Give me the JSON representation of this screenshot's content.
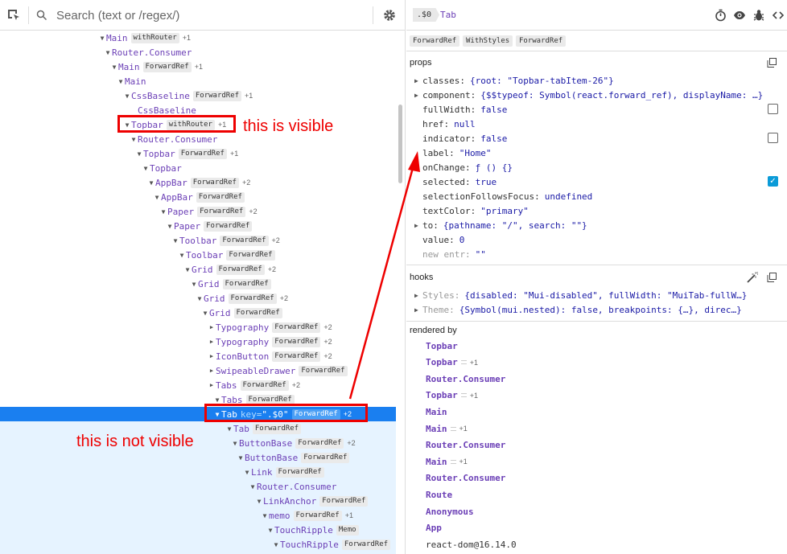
{
  "search": {
    "placeholder": "Search (text or /regex/)"
  },
  "icons": {
    "select": "cursor-select-icon",
    "search": "search-icon",
    "settings": "gear-icon",
    "timer": "stopwatch-icon",
    "inspect": "eye-icon",
    "debug": "bug-icon",
    "source": "code-icon"
  },
  "colors": {
    "accent": "#1a7ff0",
    "component": "#6b3fb6",
    "annotation": "#e00000",
    "checkbox_checked": "#0b9bd8"
  },
  "tree": [
    {
      "name": "Main",
      "badge": "withRouter",
      "plus": "+1"
    },
    {
      "name": "Router.Consumer"
    },
    {
      "name": "Main",
      "badge": "ForwardRef",
      "plus": "+1"
    },
    {
      "name": "Main"
    },
    {
      "name": "CssBaseline",
      "badge": "ForwardRef",
      "plus": "+1"
    },
    {
      "name": "CssBaseline"
    },
    {
      "name": "Topbar",
      "badge": "withRouter",
      "plus": "+1"
    },
    {
      "name": "Router.Consumer"
    },
    {
      "name": "Topbar",
      "badge": "ForwardRef",
      "plus": "+1"
    },
    {
      "name": "Topbar"
    },
    {
      "name": "AppBar",
      "badge": "ForwardRef",
      "plus": "+2"
    },
    {
      "name": "AppBar",
      "badge": "ForwardRef"
    },
    {
      "name": "Paper",
      "badge": "ForwardRef",
      "plus": "+2"
    },
    {
      "name": "Paper",
      "badge": "ForwardRef"
    },
    {
      "name": "Toolbar",
      "badge": "ForwardRef",
      "plus": "+2"
    },
    {
      "name": "Toolbar",
      "badge": "ForwardRef"
    },
    {
      "name": "Grid",
      "badge": "ForwardRef",
      "plus": "+2"
    },
    {
      "name": "Grid",
      "badge": "ForwardRef"
    },
    {
      "name": "Grid",
      "badge": "ForwardRef",
      "plus": "+2"
    },
    {
      "name": "Grid",
      "badge": "ForwardRef"
    },
    {
      "name": "Typography",
      "badge": "ForwardRef",
      "plus": "+2"
    },
    {
      "name": "Typography",
      "badge": "ForwardRef",
      "plus": "+2"
    },
    {
      "name": "IconButton",
      "badge": "ForwardRef",
      "plus": "+2"
    },
    {
      "name": "SwipeableDrawer",
      "badge": "ForwardRef"
    },
    {
      "name": "Tabs",
      "badge": "ForwardRef",
      "plus": "+2"
    },
    {
      "name": "Tabs",
      "badge": "ForwardRef"
    },
    {
      "name": "Tab",
      "key_label": "key=",
      "key_value": "\".$0\"",
      "badge": "ForwardRef",
      "plus": "+2",
      "selected": true
    },
    {
      "name": "Tab",
      "badge": "ForwardRef"
    },
    {
      "name": "ButtonBase",
      "badge": "ForwardRef",
      "plus": "+2"
    },
    {
      "name": "ButtonBase",
      "badge": "ForwardRef"
    },
    {
      "name": "Link",
      "badge": "ForwardRef"
    },
    {
      "name": "Router.Consumer"
    },
    {
      "name": "LinkAnchor",
      "badge": "ForwardRef"
    },
    {
      "name": "memo",
      "badge": "ForwardRef",
      "plus": "+1"
    },
    {
      "name": "TouchRipple",
      "badge": "Memo"
    },
    {
      "name": "TouchRipple",
      "badge": "ForwardRef"
    }
  ],
  "annotations": {
    "visible": "this is visible",
    "not_visible": "this is not visible"
  },
  "inspector": {
    "selected_tag": ".$0",
    "selected_name": "Tab",
    "hocs": [
      "ForwardRef",
      "WithStyles",
      "ForwardRef"
    ],
    "props_title": "props",
    "props": [
      {
        "key": "classes:",
        "value": "{root: \"Topbar-tabItem-26\"}",
        "expandable": true
      },
      {
        "key": "component:",
        "value": "{$$typeof: Symbol(react.forward_ref), displayName: …}",
        "expandable": true
      },
      {
        "key": "fullWidth:",
        "value": "false",
        "checkbox": "unchecked"
      },
      {
        "key": "href:",
        "value": "null"
      },
      {
        "key": "indicator:",
        "value": "false",
        "checkbox": "unchecked"
      },
      {
        "key": "label:",
        "value": "\"Home\""
      },
      {
        "key": "onChange:",
        "value": "ƒ () {}"
      },
      {
        "key": "selected:",
        "value": "true",
        "checkbox": "checked"
      },
      {
        "key": "selectionFollowsFocus:",
        "value": "undefined"
      },
      {
        "key": "textColor:",
        "value": "\"primary\""
      },
      {
        "key": "to:",
        "value": "{pathname: \"/\", search: \"\"}",
        "expandable": true
      },
      {
        "key": "value:",
        "value": "0"
      },
      {
        "key": "new entr:",
        "value": "\"\"",
        "dim": true
      }
    ],
    "hooks_title": "hooks",
    "hooks": [
      {
        "key": "Styles:",
        "value": "{disabled: \"Mui-disabled\", fullWidth: \"MuiTab-fullW…}"
      },
      {
        "key": "Theme:",
        "value": "{Symbol(mui.nested): false, breakpoints: {…}, direc…}"
      }
    ],
    "rendered_by_title": "rendered by",
    "rendered_by": [
      {
        "name": "Topbar"
      },
      {
        "name": "Topbar",
        "plus": "+1"
      },
      {
        "name": "Router.Consumer"
      },
      {
        "name": "Topbar",
        "plus": "+1"
      },
      {
        "name": "Main"
      },
      {
        "name": "Main",
        "plus": "+1"
      },
      {
        "name": "Router.Consumer"
      },
      {
        "name": "Main",
        "plus": "+1"
      },
      {
        "name": "Router.Consumer"
      },
      {
        "name": "Route"
      },
      {
        "name": "Anonymous"
      },
      {
        "name": "App"
      },
      {
        "name": "react-dom@16.14.0",
        "plain": true
      }
    ]
  }
}
